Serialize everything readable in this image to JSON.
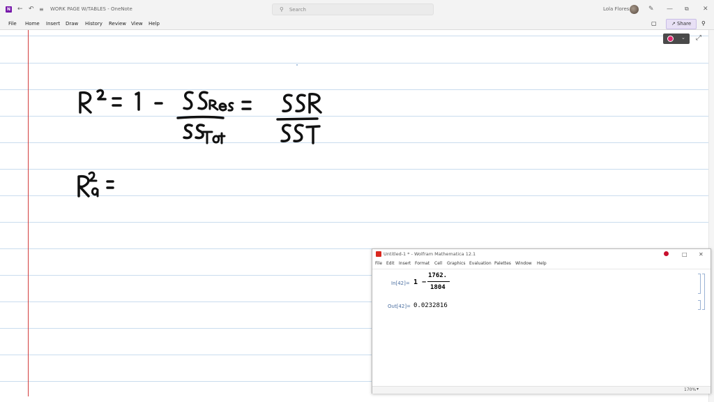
{
  "titlebar": {
    "doc_title": "WORK PAGE W/TABLES",
    "app_name": "OneNote",
    "separator": "-",
    "search_placeholder": "Search",
    "user_name": "Lola Flores"
  },
  "menubar": {
    "items": [
      "File",
      "Home",
      "Insert",
      "Draw",
      "History",
      "Review",
      "View",
      "Help"
    ],
    "share_label": "Share"
  },
  "mathematica": {
    "window_title": "Untitled-1 * - Wolfram Mathematica 12.1",
    "menu": [
      "File",
      "Edit",
      "Insert",
      "Format",
      "Cell",
      "Graphics",
      "Evaluation",
      "Palettes",
      "Window",
      "Help"
    ],
    "input_label": "In[42]=",
    "input_prefix": "1 −",
    "input_numerator": "1762.",
    "input_denominator": "1804",
    "output_label": "Out[42]=",
    "output_value": "0.0232816",
    "zoom": "170%"
  },
  "colors": {
    "margin_line": "#d23c3c",
    "rule_line": "#c9dcee",
    "onenote_purple": "#7719aa",
    "pen_color": "#e0286f"
  }
}
